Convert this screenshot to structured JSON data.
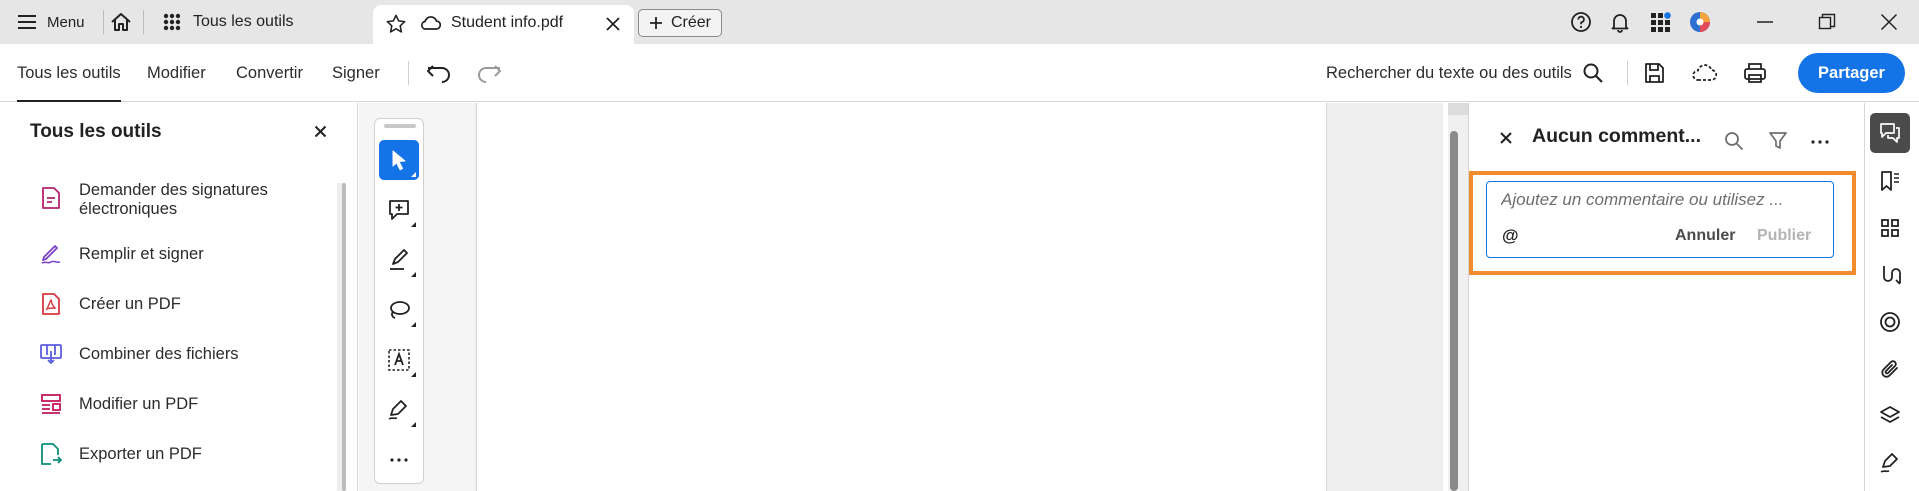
{
  "titlebar": {
    "menu_label": "Menu",
    "tab_tools_label": "Tous les outils",
    "tab_document_label": "Student info.pdf",
    "create_label": "Créer"
  },
  "toolbar": {
    "tabs": [
      {
        "label": "Tous les outils",
        "active": true
      },
      {
        "label": "Modifier",
        "active": false
      },
      {
        "label": "Convertir",
        "active": false
      },
      {
        "label": "Signer",
        "active": false
      }
    ],
    "search_label": "Rechercher du texte ou des outils",
    "share_label": "Partager"
  },
  "left_panel": {
    "title": "Tous les outils",
    "items": [
      {
        "label": "Demander des signatures électroniques",
        "icon": "request-signature-icon",
        "color": "#b4236c"
      },
      {
        "label": "Remplir et signer",
        "icon": "fill-sign-icon",
        "color": "#7b44c9"
      },
      {
        "label": "Créer un PDF",
        "icon": "create-pdf-icon",
        "color": "#d7373f"
      },
      {
        "label": "Combiner des fichiers",
        "icon": "combine-files-icon",
        "color": "#5c5ce0"
      },
      {
        "label": "Modifier un PDF",
        "icon": "edit-pdf-icon",
        "color": "#c2185b"
      },
      {
        "label": "Exporter un PDF",
        "icon": "export-pdf-icon",
        "color": "#0d8f7c"
      }
    ]
  },
  "tool_rail": {
    "tools": [
      {
        "name": "select-tool",
        "icon": "cursor-icon",
        "selected": true
      },
      {
        "name": "add-comment-tool",
        "icon": "comment-plus-icon",
        "selected": false
      },
      {
        "name": "highlight-tool",
        "icon": "highlighter-icon",
        "selected": false
      },
      {
        "name": "draw-tool",
        "icon": "lasso-icon",
        "selected": false
      },
      {
        "name": "text-tool",
        "icon": "text-box-icon",
        "selected": false
      },
      {
        "name": "sign-tool",
        "icon": "pen-sign-icon",
        "selected": false
      },
      {
        "name": "more-tools",
        "icon": "ellipsis-icon",
        "selected": false
      }
    ]
  },
  "comments_panel": {
    "title": "Aucun comment...",
    "placeholder": "Ajoutez un commentaire ou utilisez ...",
    "mention_symbol": "@",
    "cancel_label": "Annuler",
    "publish_label": "Publier"
  },
  "colors": {
    "accent": "#1473e6",
    "highlight": "#f08c2e",
    "titlebar_bg": "#e6e6e6"
  }
}
